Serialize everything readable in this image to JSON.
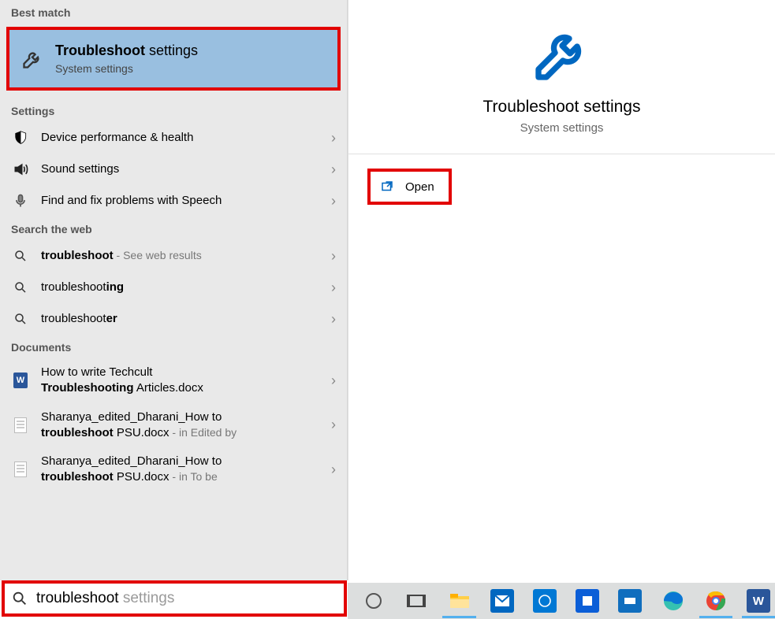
{
  "sections": {
    "best_match": "Best match",
    "settings": "Settings",
    "web": "Search the web",
    "documents": "Documents"
  },
  "best": {
    "title_pre": "Troubleshoot",
    "title_post": " settings",
    "sub": "System settings"
  },
  "settings_rows": [
    {
      "label": "Device performance & health"
    },
    {
      "label": "Sound settings"
    },
    {
      "label": "Find and fix problems with Speech"
    }
  ],
  "web_rows": {
    "r1_term": "troubleshoot",
    "r1_hint": " - See web results",
    "r2_pre": "troubleshoot",
    "r2_bold": "ing",
    "r3_pre": "troubleshoot",
    "r3_bold": "er"
  },
  "documents_rows": {
    "d1_l1": "How to write Techcult ",
    "d1_bold": "Troubleshooting",
    "d1_post": " Articles.docx",
    "d2_l1": "Sharanya_edited_Dharani_How to ",
    "d2_bold": "troubleshoot",
    "d2_post": " PSU.docx",
    "d2_hint": " - in Edited by",
    "d3_l1": "Sharanya_edited_Dharani_How to ",
    "d3_bold": "troubleshoot",
    "d3_post": " PSU.docx",
    "d3_hint": " - in To be"
  },
  "preview": {
    "title": "Troubleshoot settings",
    "sub": "System settings",
    "open": "Open"
  },
  "search": {
    "value": "troubleshoot",
    "ghost_typed": "troubleshoot",
    "ghost_suffix": " settings"
  },
  "colors": {
    "highlight_border": "#e20000",
    "best_bg": "#99bfe0",
    "accent": "#0067c0"
  }
}
